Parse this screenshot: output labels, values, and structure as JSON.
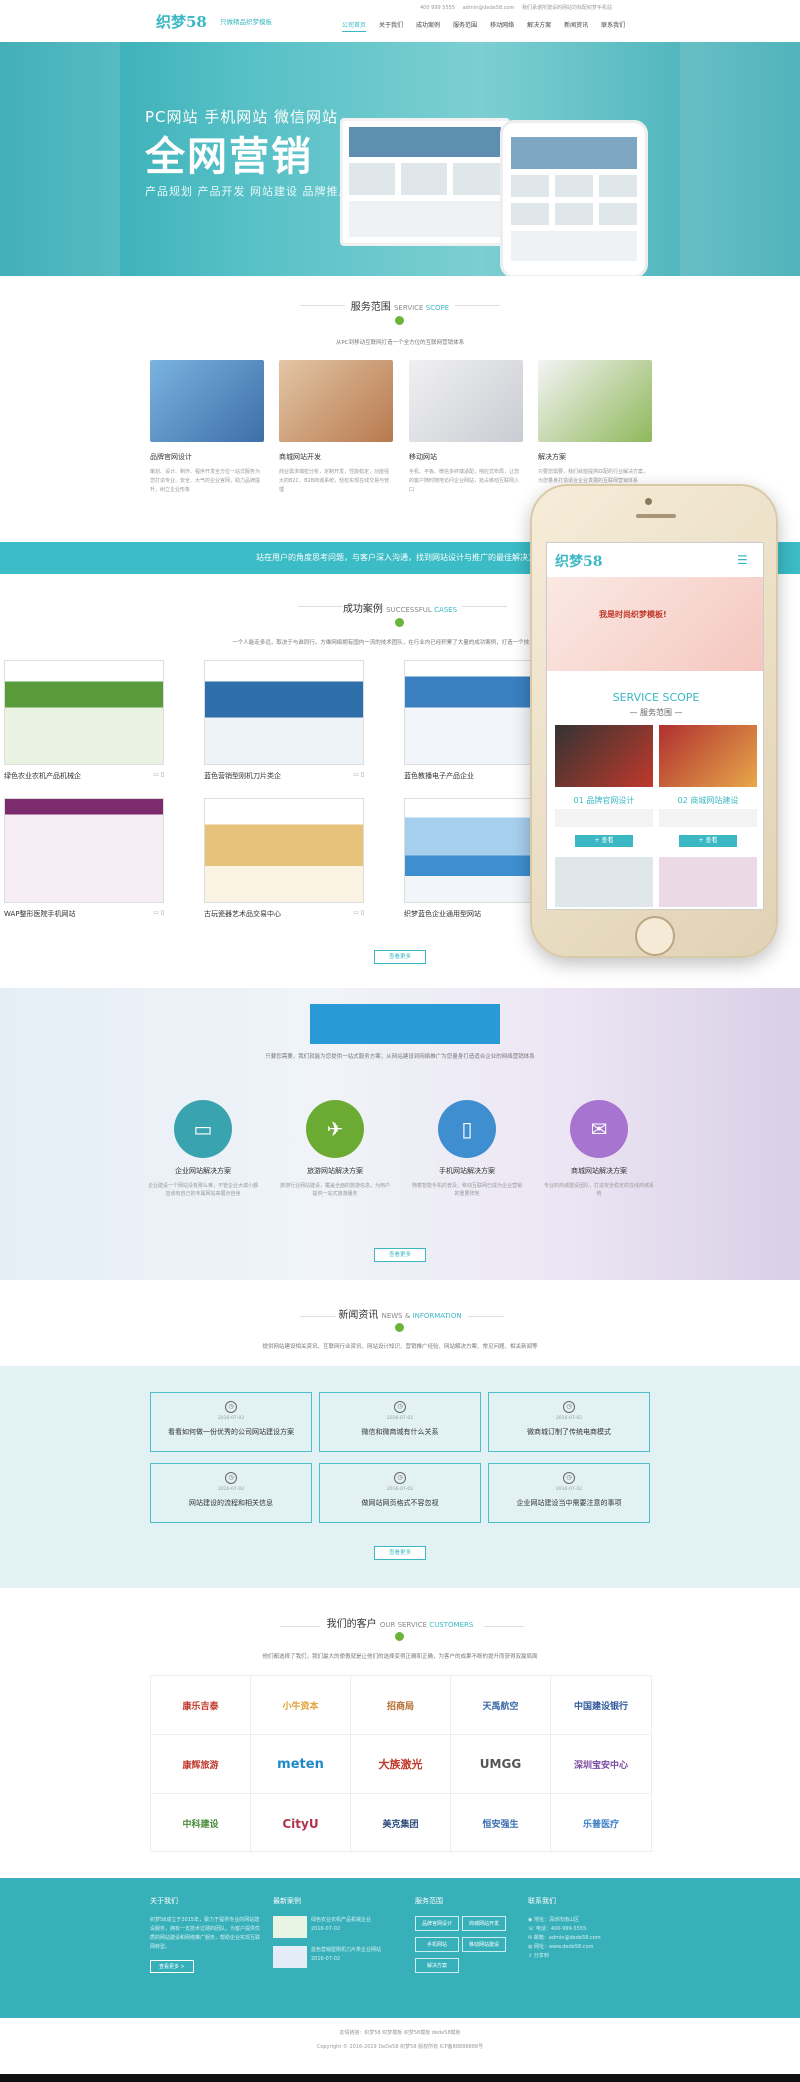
{
  "header": {
    "logo": "织梦58",
    "slogan": "只做精品织梦模板",
    "phone": "400 999 5555",
    "email": "admin@dede58.com",
    "notice": "我们承诺所建设的网站均标配织梦手机站",
    "nav": [
      "公司首页",
      "关于我们",
      "成功案例",
      "服务范围",
      "移动网络",
      "解决方案",
      "新闻资讯",
      "联系我们"
    ]
  },
  "banner": {
    "line1": "PC网站  手机网站  微信网站",
    "big": "全网营销",
    "sub": "产品规划  产品开发  网站建设  品牌推广"
  },
  "services": {
    "title": "服务范围",
    "en_a": "SERVICE",
    "en_b": "SCOPE",
    "desc": "从PC到移动互联网打造一个全方位的互联网营销体系",
    "items": [
      {
        "title": "品牌官网设计",
        "text": "策划、设计、制作、程序开发全方位一站式服务为您打造专业、安全、大气的企业官网，助力品牌提升，树立企业形象",
        "color": "#3e6fa8"
      },
      {
        "title": "商城网站开发",
        "text": "商业需求缜密分析，定制开发，性能稳定，功能强大的B2C、B2B商城系统，轻松实现在线交易与管理",
        "color": "#b8794e"
      },
      {
        "title": "移动网站",
        "text": "手机、平板、微信多终端适配，响应式布局，让您的客户随时随地访问企业网站，抢占移动互联网入口",
        "color": "#c9ccd2"
      },
      {
        "title": "解决方案",
        "text": "只要您需要，我们就能提供匹配的行业解决方案，为您量身打造适合企业发展的互联网营销体系",
        "color": "#8fb85c"
      }
    ]
  },
  "strip": "站在用户的角度思考问题，与客户深入沟通，找到网站设计与推广的最佳解决方案",
  "cases": {
    "title": "成功案例",
    "en_a": "SUCCESSFUL",
    "en_b": "CASES",
    "desc": "一个人能走多远，取决于与谁同行。方维网络拥有国内一流的技术团队，在行业内已经积累了大量的成功案例，打造一个技术专业化的团队",
    "items": [
      {
        "name": "绿色农业农机产品机械企",
        "color": "#5a9c3c"
      },
      {
        "name": "蓝色营销型刚机刀片类企",
        "color": "#2e6faa"
      },
      {
        "name": "蓝色教播电子产品企业",
        "color": "#3a7fc0"
      },
      {
        "name": "WAP整形医院手机网站",
        "color": "#7c2c6c"
      },
      {
        "name": "古玩瓷器艺术品交易中心",
        "color": "#c49a3c"
      },
      {
        "name": "织梦蓝色企业通用型网站",
        "color": "#3e8fd0"
      }
    ],
    "more": "查看更多"
  },
  "phone_mock": {
    "logo": "织梦58",
    "banner_text": "我是时尚织梦模板!",
    "scope_en": "SERVICE SCOPE",
    "scope_cn": "— 服务范围 —",
    "item1": "01 品牌官网设计",
    "item2": "02 商城网站建设",
    "more": "+ 查看"
  },
  "solutions": {
    "intro": "只要您需要，我们就能为您提供一站式服务方案，从网站建设到网络推广为您量身打造适合企业的网络营销体系",
    "items": [
      {
        "title": "企业网站解决方案",
        "text": "企业建设一个网站没有那么难，不管企业大或小都应该有自己的专属网站来展示自身",
        "color": "#3aa3b0",
        "icon": "laptop-icon"
      },
      {
        "title": "旅游网站解决方案",
        "text": "旅游行业网站建设，覆盖全面的旅游信息，为用户提供一站式旅游服务",
        "color": "#6cab33",
        "icon": "plane-icon"
      },
      {
        "title": "手机网站解决方案",
        "text": "随着智能手机的普及，移动互联网已成为企业营销的重要阵地",
        "color": "#3f8fd0",
        "icon": "mobile-icon"
      },
      {
        "title": "商城网站解决方案",
        "text": "专业的商城建设团队，打造安全稳定的在线商城系统",
        "color": "#a774d0",
        "icon": "bag-icon"
      }
    ],
    "more": "查看更多"
  },
  "news": {
    "title": "新闻资讯",
    "en_a": "NEWS",
    "en_b": "INFORMATION",
    "desc": "提供网站建设相关资讯、互联网行业资讯、网站设计知识、营销推广经验、网站解决方案、常见问题、相关新闻等",
    "items": [
      {
        "date": "2016-07-02",
        "title": "看看如何做一份优秀的公司网站建设方案"
      },
      {
        "date": "2016-07-02",
        "title": "微信和微商城有什么关系"
      },
      {
        "date": "2016-07-02",
        "title": "微商城订制了传统电商模式"
      },
      {
        "date": "2016-07-02",
        "title": "网站建设的流程和相关信息"
      },
      {
        "date": "2016-07-02",
        "title": "做网站网页格式不容忽视"
      },
      {
        "date": "2016-07-02",
        "title": "企业网站建设当中需要注意的事项"
      }
    ],
    "more": "查看更多"
  },
  "clients": {
    "title": "我们的客户",
    "en_a": "OUR SERVICE",
    "en_b": "CUSTOMERS",
    "desc": "他们都选择了我们，我们最大的骄傲就是让他们的选择变得正确和正确，为客户的成果不断的提升而获得双赢局面",
    "logos": [
      {
        "name": "康乐吉泰",
        "color": "#c0392b"
      },
      {
        "name": "小牛资本",
        "color": "#e2a23a"
      },
      {
        "name": "招商局",
        "color": "#b46b2a"
      },
      {
        "name": "天禹航空",
        "color": "#3b6aa8"
      },
      {
        "name": "中国建设银行",
        "color": "#2f5a9c"
      },
      {
        "name": "康辉旅游",
        "color": "#c0392b"
      },
      {
        "name": "meten",
        "color": "#1e88c8"
      },
      {
        "name": "大族激光",
        "color": "#c0392b"
      },
      {
        "name": "UMGG",
        "color": "#555555"
      },
      {
        "name": "深圳宝安中心",
        "color": "#7a4aa0"
      },
      {
        "name": "中科建设",
        "color": "#4a8a3a"
      },
      {
        "name": "CityU",
        "color": "#b0344c"
      },
      {
        "name": "美克集团",
        "color": "#2c4a7a"
      },
      {
        "name": "恒安强生",
        "color": "#3a6fb0"
      },
      {
        "name": "乐普医疗",
        "color": "#3a7fc8"
      }
    ]
  },
  "footer": {
    "about_title": "关于我们",
    "about_text": "织梦58成立于2015年，致力于提供专业的网站建设服务，拥有一支技术过硬的团队，为客户提供优质的网站建设和网络推广服务，帮助企业实现互联网转型。",
    "about_btn": "查看更多 >",
    "cases_title": "最新案例",
    "case1": "绿色农业农机产品机械企业",
    "case1_sub": "2016-07-02",
    "case2": "蓝色营销型刚机刀片类企业网站",
    "case2_sub": "2016-07-02",
    "scope_title": "服务范围",
    "scope": [
      "品牌官网设计",
      "商城网站开发",
      "手机网站",
      "移动网站建设",
      "解决方案"
    ],
    "contact_title": "联系我们",
    "contact": [
      "地址：深圳市南山区",
      "电话：400-999-5555",
      "邮箱：admin@dede58.com",
      "网址：www.dede58.com",
      "分享到"
    ]
  },
  "copyright": {
    "line1": "友情链接：织梦58  织梦模板  织梦58模板  dede58模板",
    "line2": "Copyright © 2016-2019 DeDe58 织梦58 版权所有 ICP备88888888号"
  }
}
